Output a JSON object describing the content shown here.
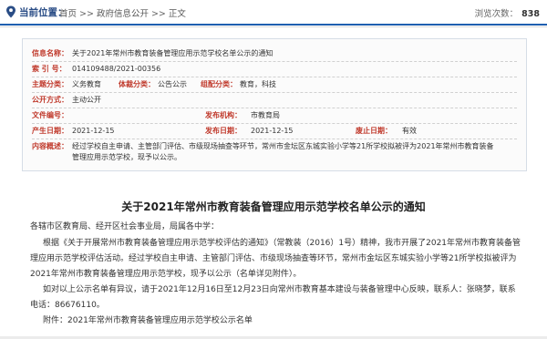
{
  "breadcrumb": {
    "label": "当前位置：",
    "items": [
      "首页",
      "政府信息公开",
      "正文"
    ],
    "separator": ">>",
    "views_label": "浏览次数：",
    "views_count": "838"
  },
  "meta": {
    "info_name": {
      "label": "信息名称：",
      "value": "关于2021年常州市教育装备管理应用示范学校名单公示的通知"
    },
    "index_no": {
      "label": "索  引 号：",
      "value": "014109488/2021-00356"
    },
    "theme": {
      "label": "主题分类：",
      "value": "义务教育"
    },
    "genre": {
      "label": "体裁分类：",
      "value": "公告公示"
    },
    "org_type": {
      "label": "组配分类：",
      "value": "教育，科技"
    },
    "open_mode": {
      "label": "公开方式：",
      "value": "主动公开"
    },
    "doc_no": {
      "label": "文件编号：",
      "value": ""
    },
    "issuer": {
      "label": "发布机构：",
      "value": "市教育局"
    },
    "created": {
      "label": "产生日期：",
      "value": "2021-12-15"
    },
    "published": {
      "label": "发布日期：",
      "value": "2021-12-15"
    },
    "abolished": {
      "label": "废止日期：",
      "value": "有效"
    },
    "summary": {
      "label": "内容概述：",
      "value": "经过学校自主申请、主管部门评估、市级现场抽查等环节，常州市金坛区东城实验小学等21所学校拟被评为2021年常州市教育装备管理应用示范学校，现予以公示。"
    }
  },
  "article": {
    "title": "关于2021年常州市教育装备管理应用示范学校名单公示的通知",
    "salutation": "各辖市区教育局、经开区社会事业局，局属各中学：",
    "para1": "根据《关于开展常州市教育装备管理应用示范学校评估的通知》（常教装（2016）1号）精神，我市开展了2021年常州市教育装备管理应用示范学校评估活动。经过学校自主申请、主管部门评估、市级现场抽查等环节，常州市金坛区东城实验小学等21所学校拟被评为2021年常州市教育装备管理应用示范学校，现予以公示（名单详见附件）。",
    "para2": "如对以上公示名单有异议，请于2021年12月16日至12月23日向常州市教育基本建设与装备管理中心反映，联系人：张晓梦，联系电话：86676110。",
    "attachment": "附件：2021年常州市教育装备管理应用示范学校公示名单"
  },
  "colors": {
    "accent_blue": "#1f5fb0",
    "label_red": "#c0392b",
    "crumb_label": "#2a4d86"
  },
  "icons": {
    "location": "map-pin-icon"
  }
}
